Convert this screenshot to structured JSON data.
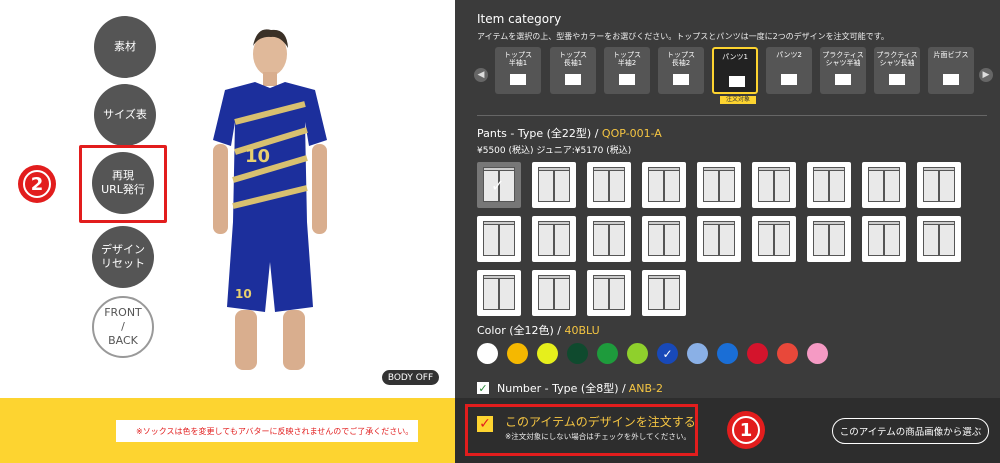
{
  "left": {
    "buttons": [
      {
        "label": "素材"
      },
      {
        "label": "サイズ表"
      },
      {
        "label": "再現\nURL発行"
      },
      {
        "label": "デザイン\nリセット"
      },
      {
        "label": "FRONT\n/\nBACK"
      }
    ],
    "marker_2": "2",
    "body_off": "BODY OFF",
    "notice": "※ソックスは色を変更してもアバターに反映されませんのでご了承ください。",
    "jersey_number": "10"
  },
  "right": {
    "category_title": "Item category",
    "category_desc": "アイテムを選択の上、型番やカラーをお選びください。トップスとパンツは一度に2つのデザインを注文可能です。",
    "categories": [
      {
        "label": "トップス\n半袖1"
      },
      {
        "label": "トップス\n長袖1"
      },
      {
        "label": "トップス\n半袖2"
      },
      {
        "label": "トップス\n長袖2"
      },
      {
        "label": "パンツ1"
      },
      {
        "label": "パンツ2"
      },
      {
        "label": "プラクティス\nシャツ半袖"
      },
      {
        "label": "プラクティス\nシャツ長袖"
      },
      {
        "label": "片面ビブス"
      }
    ],
    "category_badge": "注文対象",
    "pants_title": "Pants - Type (全22型) / ",
    "pants_code": "QOP-001-A",
    "price": "¥5500 (税込) ジュニア:¥5170 (税込)",
    "color_title": "Color (全12色) / ",
    "color_code": "40BLU",
    "colors": [
      "#ffffff",
      "#f5b800",
      "#e6ef1c",
      "#0f4a2e",
      "#1e9b3c",
      "#8fd02c",
      "#1849b8",
      "#8ab0e6",
      "#1a6ed6",
      "#d4142c",
      "#e8483a",
      "#f59ac4"
    ],
    "number_title": "Number - Type (全8型) / ",
    "number_code": "ANB-2",
    "order_label": "このアイテムのデザインを注文する",
    "order_sub": "※注文対象にしない場合はチェックを外してください。",
    "marker_1": "1",
    "image_button": "このアイテムの商品画像から選ぶ"
  }
}
